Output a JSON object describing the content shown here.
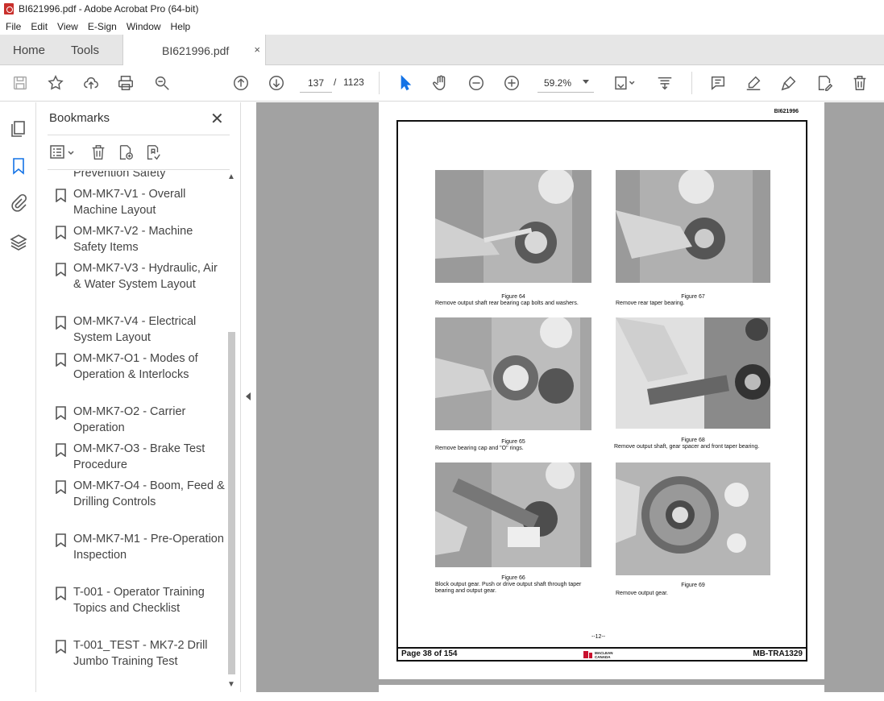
{
  "window": {
    "title": "BI621996.pdf - Adobe Acrobat Pro (64-bit)"
  },
  "menu": [
    "File",
    "Edit",
    "View",
    "E-Sign",
    "Window",
    "Help"
  ],
  "tabs": {
    "home": "Home",
    "tools": "Tools",
    "document": "BI621996.pdf",
    "close": "×"
  },
  "toolbar": {
    "page_current": "137",
    "page_sep": "/",
    "page_total": "1123",
    "zoom": "59.2%"
  },
  "bookmarks_panel": {
    "title": "Bookmarks",
    "close": "✕",
    "partial_item": "Prevention Safety",
    "items": [
      {
        "label": "OM-MK7-V1 - Overall Machine Layout"
      },
      {
        "label": "OM-MK7-V2 - Machine Safety Items"
      },
      {
        "label": "OM-MK7-V3 - Hydraulic, Air & Water System Layout"
      },
      {
        "label": "OM-MK7-V4 - Electrical System Layout"
      },
      {
        "label": "OM-MK7-O1 - Modes of Operation & Interlocks"
      },
      {
        "label": "OM-MK7-O2 - Carrier Operation"
      },
      {
        "label": "OM-MK7-O3 - Brake Test Procedure"
      },
      {
        "label": "OM-MK7-O4 - Boom, Feed & Drilling Controls"
      },
      {
        "label": "OM-MK7-M1 - Pre-Operation Inspection"
      },
      {
        "label": "T-001 - Operator Training Topics and Checklist"
      },
      {
        "label": "T-001_TEST - MK7-2 Drill Jumbo Training Test"
      }
    ]
  },
  "document": {
    "doc_id": "BI621996",
    "figures": [
      {
        "fig": "Figure 64",
        "caption": "Remove output shaft rear bearing cap bolts and washers."
      },
      {
        "fig": "Figure 67",
        "caption": "Remove rear taper bearing."
      },
      {
        "fig": "Figure 65",
        "caption": "Remove bearing cap and \"O\" rings."
      },
      {
        "fig": "Figure 68",
        "caption": "Remove output shaft, gear spacer and front taper bearing."
      },
      {
        "fig": "Figure 66",
        "caption": "Block output gear. Push or drive output shaft through taper bearing and output gear."
      },
      {
        "fig": "Figure 69",
        "caption": "Remove output gear."
      }
    ],
    "page_number": "--12--",
    "footer_left": "Page 38 of 154",
    "footer_logo": "MACLEAN CANADA",
    "footer_right": "MB-TRA1329"
  }
}
